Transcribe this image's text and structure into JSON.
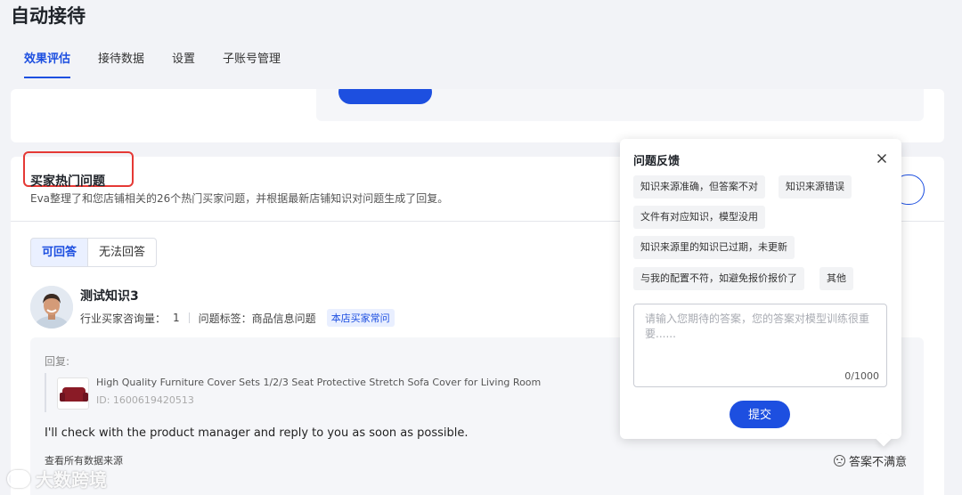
{
  "page": {
    "title": "自动接待"
  },
  "tabs": [
    {
      "label": "效果评估",
      "active": true
    },
    {
      "label": "接待数据"
    },
    {
      "label": "设置"
    },
    {
      "label": "子账号管理"
    }
  ],
  "hot_questions": {
    "title": "买家热门问题",
    "description": "Eva整理了和您店铺相关的26个热门买家问题，并根据最新店铺知识对问题生成了回复。",
    "segments": {
      "answerable": "可回答",
      "unanswerable": "无法回答"
    }
  },
  "question": {
    "title": "测试知识3",
    "consult_label": "行业买家咨询量：",
    "consult_value": "1",
    "tag_label": "问题标签：",
    "tag_value": "商品信息问题",
    "badge": "本店买家常问"
  },
  "reply": {
    "label": "回复:",
    "product_name": "High Quality Furniture Cover Sets 1/2/3 Seat Protective Stretch Sofa Cover for Living Room",
    "product_id": "ID: 1600619420513",
    "text": "I'll check with the product manager and reply to you as soon as possible.",
    "sources_link": "查看所有数据来源",
    "dislike_label": "答案不满意"
  },
  "feedback_popup": {
    "title": "问题反馈",
    "options": [
      "知识来源准确，但答案不对",
      "知识来源错误",
      "文件有对应知识，模型没用",
      "知识来源里的知识已过期，未更新",
      "与我的配置不符，如避免报价报价了",
      "其他"
    ],
    "textarea_placeholder": "请输入您期待的答案，您的答案对模型训练很重要......",
    "counter": "0/1000",
    "submit_label": "提交"
  },
  "watermark": "大数跨境",
  "colors": {
    "accent": "#1d4fe0",
    "highlight": "#e53935"
  }
}
